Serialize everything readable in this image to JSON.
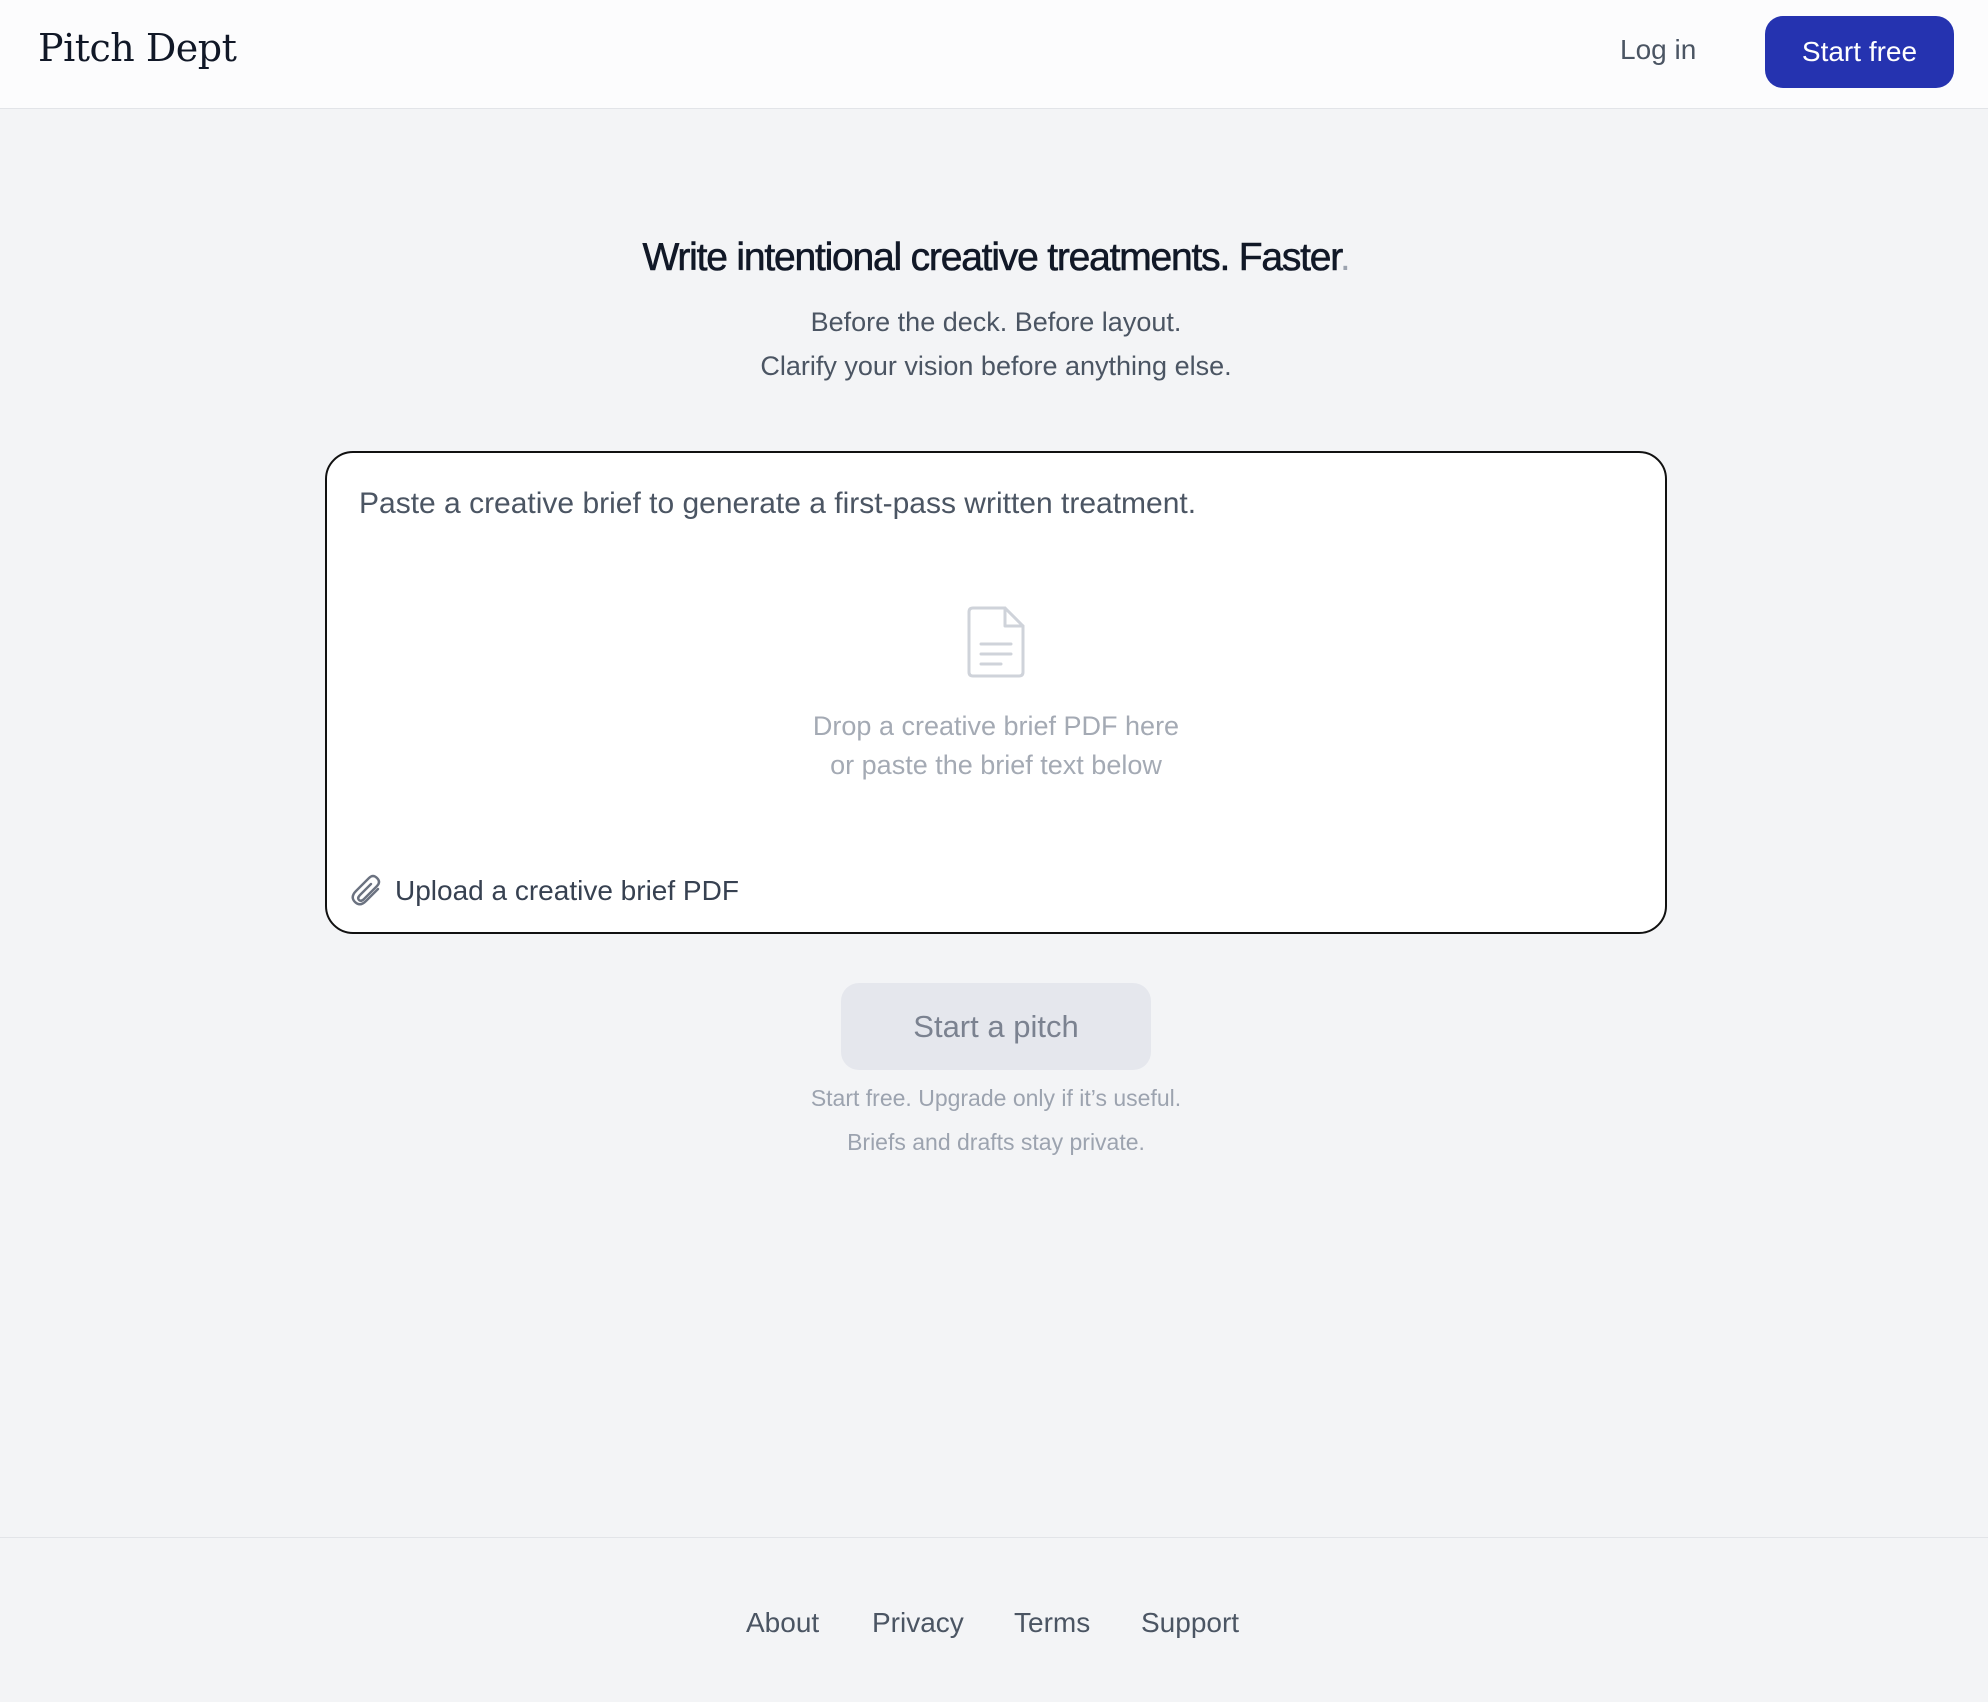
{
  "header": {
    "logo": "Pitch Dept",
    "login_label": "Log in",
    "start_free_label": "Start free",
    "accent_color": "#2533b0"
  },
  "hero": {
    "title": "Write intentional creative treatments. Faster",
    "title_dot": ".",
    "subtitle_line1": "Before the deck. Before layout.",
    "subtitle_line2": "Clarify your vision before anything else."
  },
  "brief": {
    "placeholder": "Paste a creative brief to generate a first-pass written treatment.",
    "value": "",
    "drop_icon": "document-icon",
    "drop_hint_line1": "Drop a creative brief PDF here",
    "drop_hint_line2": "or paste the brief text below",
    "upload_icon": "paperclip-icon",
    "upload_label": "Upload a creative brief PDF"
  },
  "cta": {
    "button_label": "Start a pitch",
    "note_line1": "Start free. Upgrade only if it’s useful.",
    "note_line2": "Briefs and drafts stay private."
  },
  "footer": {
    "links": [
      "About",
      "Privacy",
      "Terms",
      "Support"
    ]
  }
}
